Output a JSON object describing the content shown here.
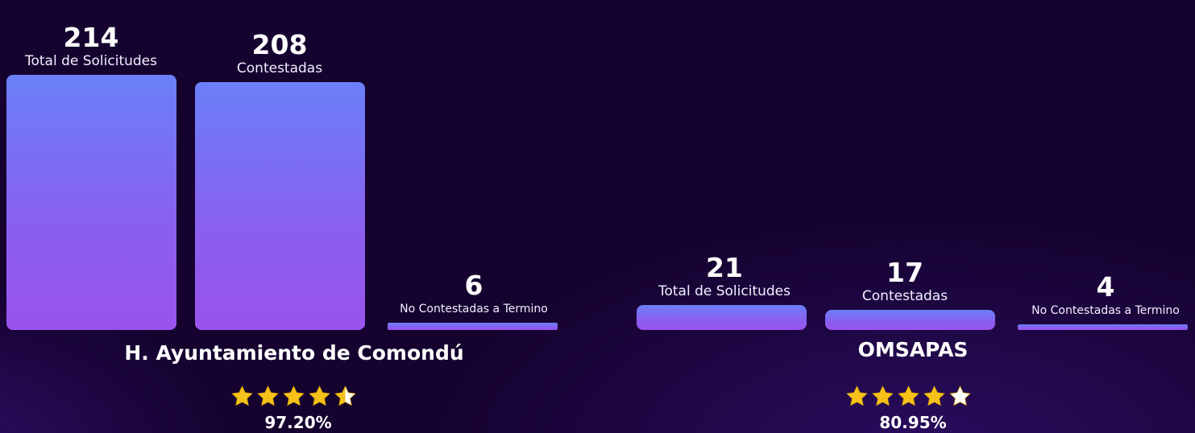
{
  "colors": {
    "bar_top": "#6a80f7",
    "bar_bottom": "#9a53ee",
    "star": "#f6c21a",
    "star_empty": "#ffffff"
  },
  "chart_data": [
    {
      "type": "bar",
      "title": "H. Ayuntamiento de Comondú",
      "categories": [
        "Total de Solicitudes",
        "Contestadas",
        "No Contestadas a Termino"
      ],
      "values": [
        214,
        208,
        6
      ],
      "ylim": [
        0,
        214
      ],
      "rating": {
        "stars": 4.5,
        "max": 5,
        "label": "97.20%"
      }
    },
    {
      "type": "bar",
      "title": "OMSAPAS",
      "categories": [
        "Total de Solicitudes",
        "Contestadas",
        "No Contestadas a Termino"
      ],
      "values": [
        21,
        17,
        4
      ],
      "ylim": [
        0,
        214
      ],
      "rating": {
        "stars": 4,
        "max": 5,
        "label": "80.95%"
      }
    }
  ]
}
